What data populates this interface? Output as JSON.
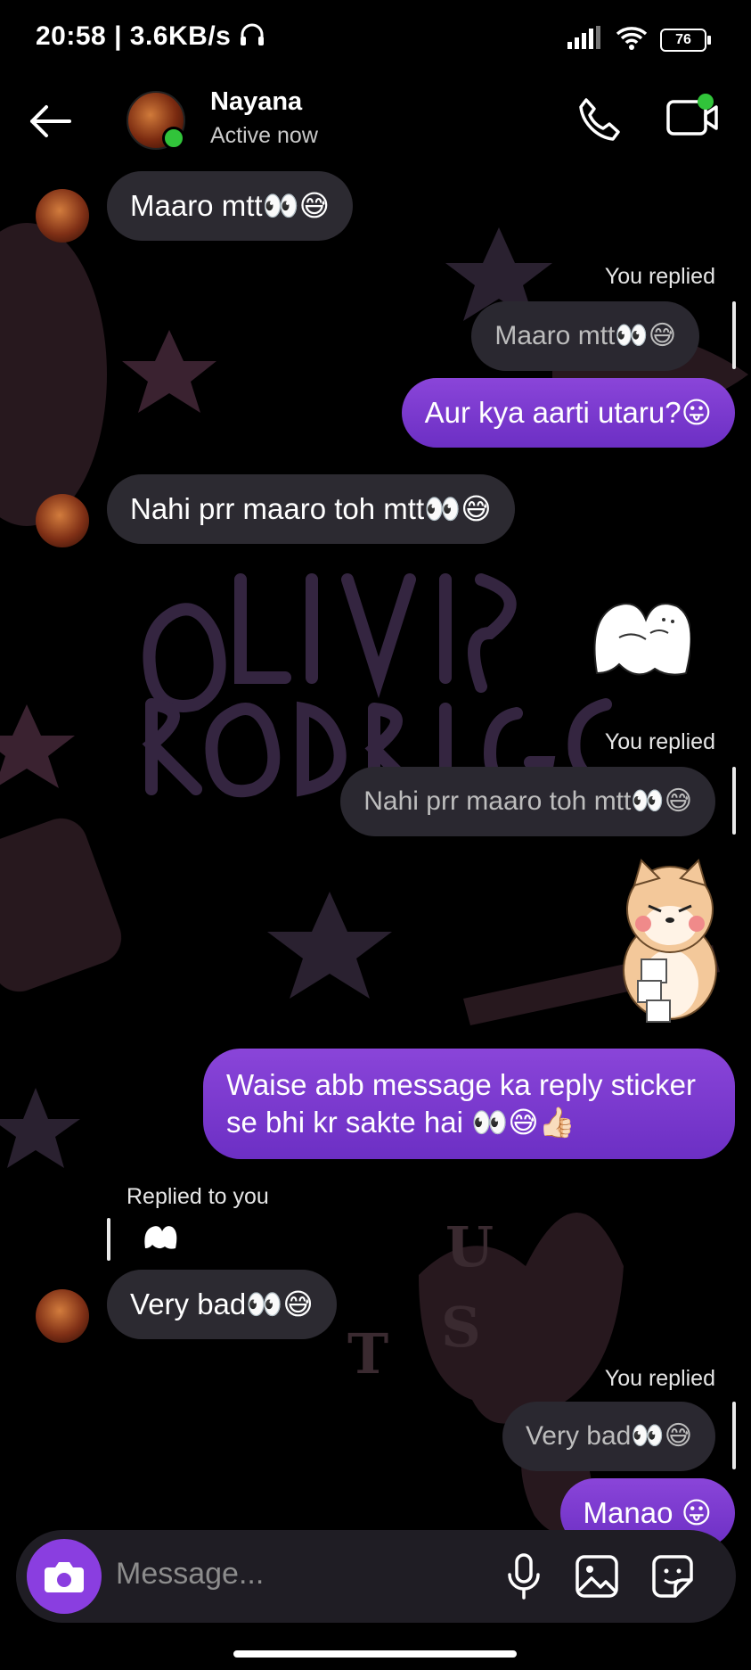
{
  "status_bar": {
    "time": "20:58 | 3.6KB/s",
    "battery": "76"
  },
  "header": {
    "contact_name": "Nayana",
    "presence": "Active now"
  },
  "messages": {
    "m1_text": "Maaro mtt",
    "m1_emoji": "👀😅",
    "you_replied_1": "You replied",
    "q1_text": "Maaro mtt",
    "q1_emoji": "👀😅",
    "m2_text": "Aur kya aarti utaru?",
    "m2_emoji": "😛",
    "m3_text": "Nahi prr maaro toh mtt",
    "m3_emoji": "👀😅",
    "you_replied_2": "You replied",
    "q2_text": "Nahi prr maaro toh mtt",
    "q2_emoji": "👀😅",
    "m4_line1": "Waise abb message ka reply sticker",
    "m4_line2": "se bhi kr sakte hai ",
    "m4_emoji": "👀😅👍🏻",
    "replied_to_you": "Replied to you",
    "m5_text": "Very bad",
    "m5_emoji": "👀😅",
    "you_replied_3": "You replied",
    "q3_text": "Very bad",
    "q3_emoji": "👀😅",
    "m6_text": "Manao ",
    "m6_emoji": "😛"
  },
  "composer": {
    "placeholder": "Message..."
  },
  "colors": {
    "outgoing_bubble": "#7a3bd2",
    "incoming_bubble": "#2c2a31",
    "online_dot": "#31c43a",
    "camera_button": "#8a3ee0"
  },
  "icons": [
    "back-arrow-icon",
    "phone-icon",
    "video-call-icon",
    "camera-icon",
    "microphone-icon",
    "gallery-icon",
    "sticker-icon",
    "wifi-icon",
    "signal-icon",
    "headphones-icon"
  ]
}
